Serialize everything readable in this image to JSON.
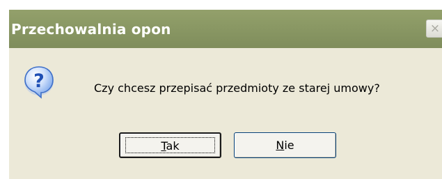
{
  "dialog": {
    "title": "Przechowalnia opon",
    "close_glyph": "×",
    "icon": "question-icon",
    "message": "Czy chcesz przepisać przedmioty ze starej umowy?",
    "buttons": {
      "yes_accel": "T",
      "yes_rest": "ak",
      "no_accel": "N",
      "no_rest": "ie"
    },
    "colors": {
      "titlebar": "#8a9864",
      "body": "#ece9d8",
      "icon_blue": "#2e63c9"
    }
  }
}
